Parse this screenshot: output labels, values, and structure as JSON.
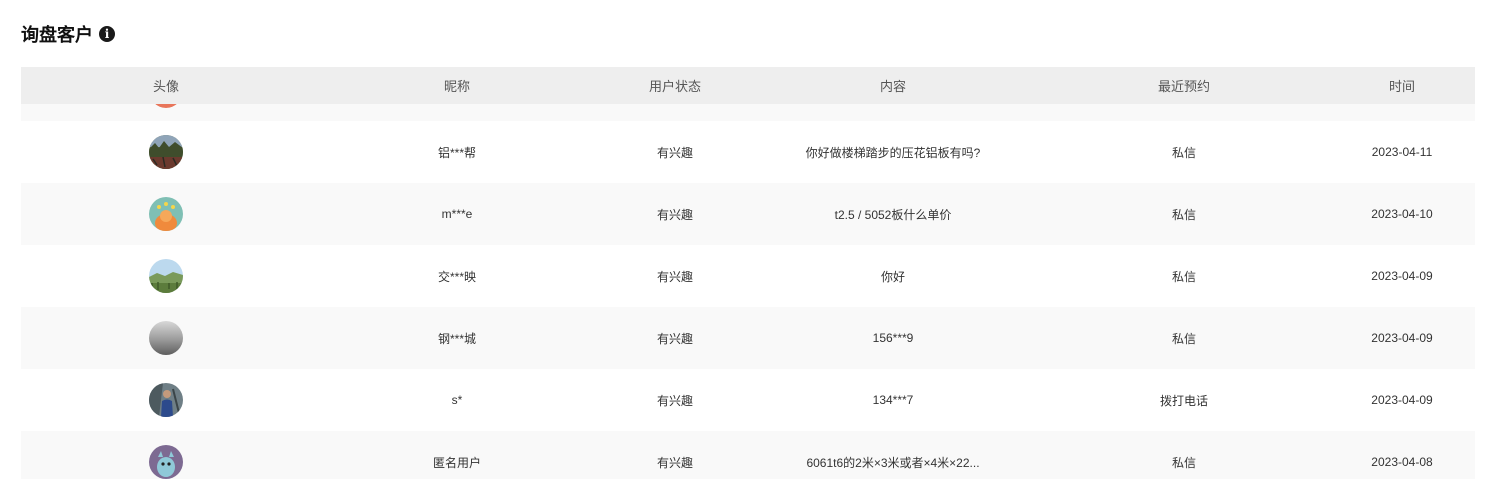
{
  "page": {
    "title": "询盘客户"
  },
  "table": {
    "columns": [
      "头像",
      "昵称",
      "用户状态",
      "内容",
      "最近预约",
      "时间"
    ],
    "rows": [
      {
        "avatar": "forest-photo-avatar",
        "nickname": "铝***帮",
        "status": "有兴趣",
        "content": "你好做楼梯踏步的压花铝板有吗?",
        "appointment": "私信",
        "time": "2023-04-11"
      },
      {
        "avatar": "cartoon-teal-avatar",
        "nickname": "m***e",
        "status": "有兴趣",
        "content": "t2.5 / 5052板什么单价",
        "appointment": "私信",
        "time": "2023-04-10"
      },
      {
        "avatar": "landscape-photo-avatar",
        "nickname": "交***映",
        "status": "有兴趣",
        "content": "你好",
        "appointment": "私信",
        "time": "2023-04-09"
      },
      {
        "avatar": "grey-fog-avatar",
        "nickname": "钢***城",
        "status": "有兴趣",
        "content": "156***9",
        "appointment": "私信",
        "time": "2023-04-09"
      },
      {
        "avatar": "person-photo-avatar",
        "nickname": "s*",
        "status": "有兴趣",
        "content": "134***7",
        "appointment": "拨打电话",
        "time": "2023-04-09"
      },
      {
        "avatar": "cartoon-purple-avatar",
        "nickname": "匿名用户",
        "status": "有兴趣",
        "content": "6061t6的2米×3米或者×4米×22...",
        "appointment": "私信",
        "time": "2023-04-08"
      }
    ]
  },
  "colors": {
    "header_bg": "#eeeeee",
    "row_alt_bg": "#f9f9f9",
    "top_avatar_peek": "#e8755a"
  }
}
